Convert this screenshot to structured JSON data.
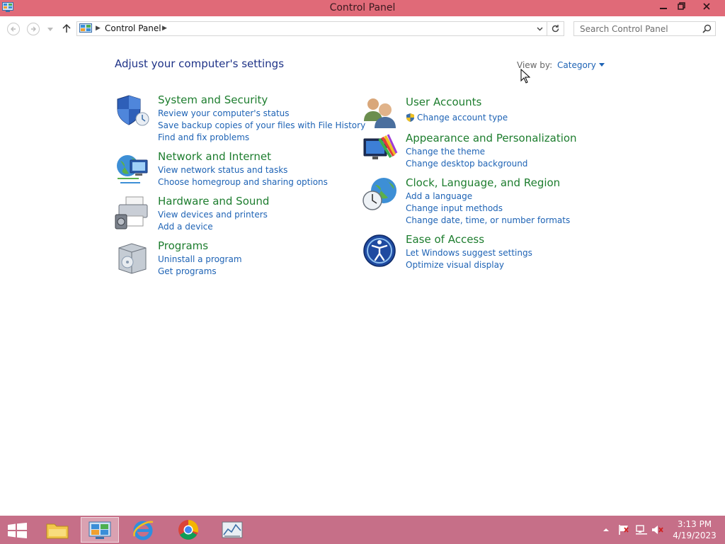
{
  "window": {
    "title": "Control Panel"
  },
  "address": {
    "crumb": "Control Panel"
  },
  "search": {
    "placeholder": "Search Control Panel"
  },
  "main": {
    "heading": "Adjust your computer's settings",
    "view_by_label": "View by:",
    "view_by_value": "Category"
  },
  "categories": [
    {
      "title": "System and Security",
      "links": [
        "Review your computer's status",
        "Save backup copies of your files with File History",
        "Find and fix problems"
      ]
    },
    {
      "title": "Network and Internet",
      "links": [
        "View network status and tasks",
        "Choose homegroup and sharing options"
      ]
    },
    {
      "title": "Hardware and Sound",
      "links": [
        "View devices and printers",
        "Add a device"
      ]
    },
    {
      "title": "Programs",
      "links": [
        "Uninstall a program",
        "Get programs"
      ]
    },
    {
      "title": "User Accounts",
      "links": [
        "Change account type"
      ]
    },
    {
      "title": "Appearance and Personalization",
      "links": [
        "Change the theme",
        "Change desktop background"
      ]
    },
    {
      "title": "Clock, Language, and Region",
      "links": [
        "Add a language",
        "Change input methods",
        "Change date, time, or number formats"
      ]
    },
    {
      "title": "Ease of Access",
      "links": [
        "Let Windows suggest settings",
        "Optimize visual display"
      ]
    }
  ],
  "taskbar": {
    "apps": [
      "file-explorer-icon",
      "control-panel-icon",
      "internet-explorer-icon",
      "chrome-icon",
      "performance-monitor-icon"
    ],
    "time": "3:13 PM",
    "date": "4/19/2023"
  },
  "colors": {
    "titlebar": "#e06a78",
    "taskbar": "#c66f88",
    "link": "#1e63b5",
    "category_title": "#1d7d2e",
    "heading": "#1e3287"
  }
}
